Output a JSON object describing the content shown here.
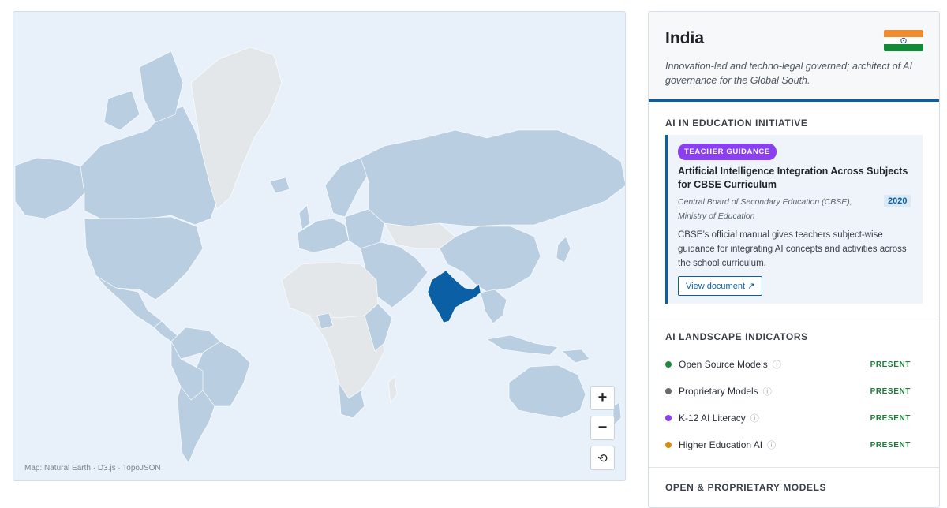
{
  "map": {
    "attribution": "Map: Natural Earth · D3.js · TopoJSON",
    "zoom_in_label": "+",
    "zoom_out_label": "−",
    "reset_label": "⟲",
    "colors": {
      "ocean": "#e8f1fa",
      "covered": "#b9cfe1",
      "uncovered": "#e4e7ea",
      "selected": "#0b5fa5"
    }
  },
  "country": {
    "name": "India",
    "flag_icon": "india-flag-icon",
    "description": "Innovation-led and techno-legal governed; architect of AI governance for the Global South."
  },
  "education": {
    "section_title": "AI IN EDUCATION INITIATIVE",
    "badge": "TEACHER GUIDANCE",
    "title": "Artificial Intelligence Integration Across Subjects for CBSE Curriculum",
    "organization": "Central Board of Secondary Education (CBSE), Ministry of Education",
    "year": "2020",
    "description": "CBSE’s official manual gives teachers subject-wise guidance for integrating AI concepts and activities across the school curriculum.",
    "link_label": "View document ↗"
  },
  "indicators": {
    "section_title": "AI LANDSCAPE INDICATORS",
    "items": [
      {
        "label": "Open Source Models",
        "status": "PRESENT",
        "color": "#1f8a3a"
      },
      {
        "label": "Proprietary Models",
        "status": "PRESENT",
        "color": "#666b70"
      },
      {
        "label": "K-12 AI Literacy",
        "status": "PRESENT",
        "color": "#8a3ff0"
      },
      {
        "label": "Higher Education AI",
        "status": "PRESENT",
        "color": "#d98a10"
      }
    ],
    "info_icon": "ⓘ"
  },
  "models": {
    "section_title": "OPEN & PROPRIETARY MODELS"
  }
}
